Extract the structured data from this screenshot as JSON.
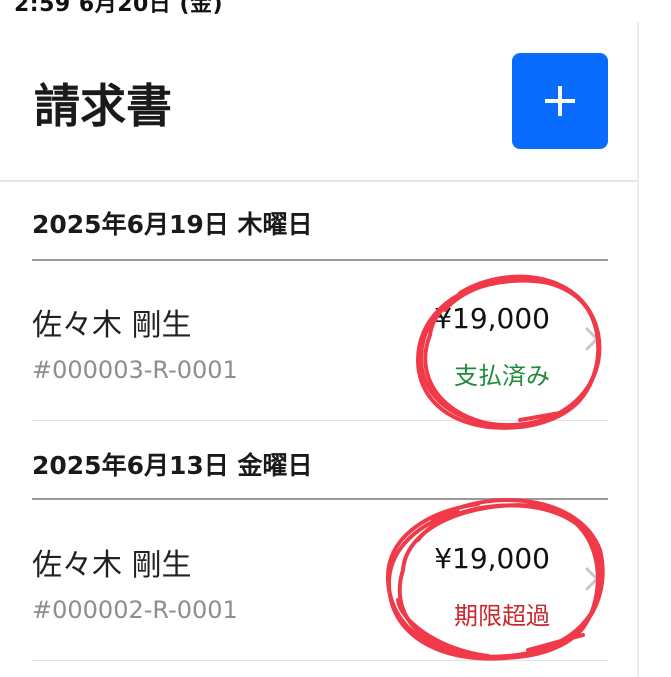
{
  "status_bar": {
    "text": "2:59 6月20日 (金)"
  },
  "header": {
    "title": "請求書",
    "add_label": "+"
  },
  "sections": [
    {
      "date": "2025年6月19日 木曜日",
      "invoices": [
        {
          "customer": "佐々木 剛生",
          "number": "#000003-R-0001",
          "amount": "¥19,000",
          "status": "支払済み",
          "status_color": "#1f8a3a"
        }
      ]
    },
    {
      "date": "2025年6月13日 金曜日",
      "invoices": [
        {
          "customer": "佐々木 剛生",
          "number": "#000002-R-0001",
          "amount": "¥19,000",
          "status": "期限超過",
          "status_color": "#c8282e"
        }
      ]
    }
  ],
  "colors": {
    "accent": "#0a6cff",
    "annotation": "#f03a4a"
  },
  "icons": [
    "plus-icon",
    "chevron-right-icon"
  ]
}
